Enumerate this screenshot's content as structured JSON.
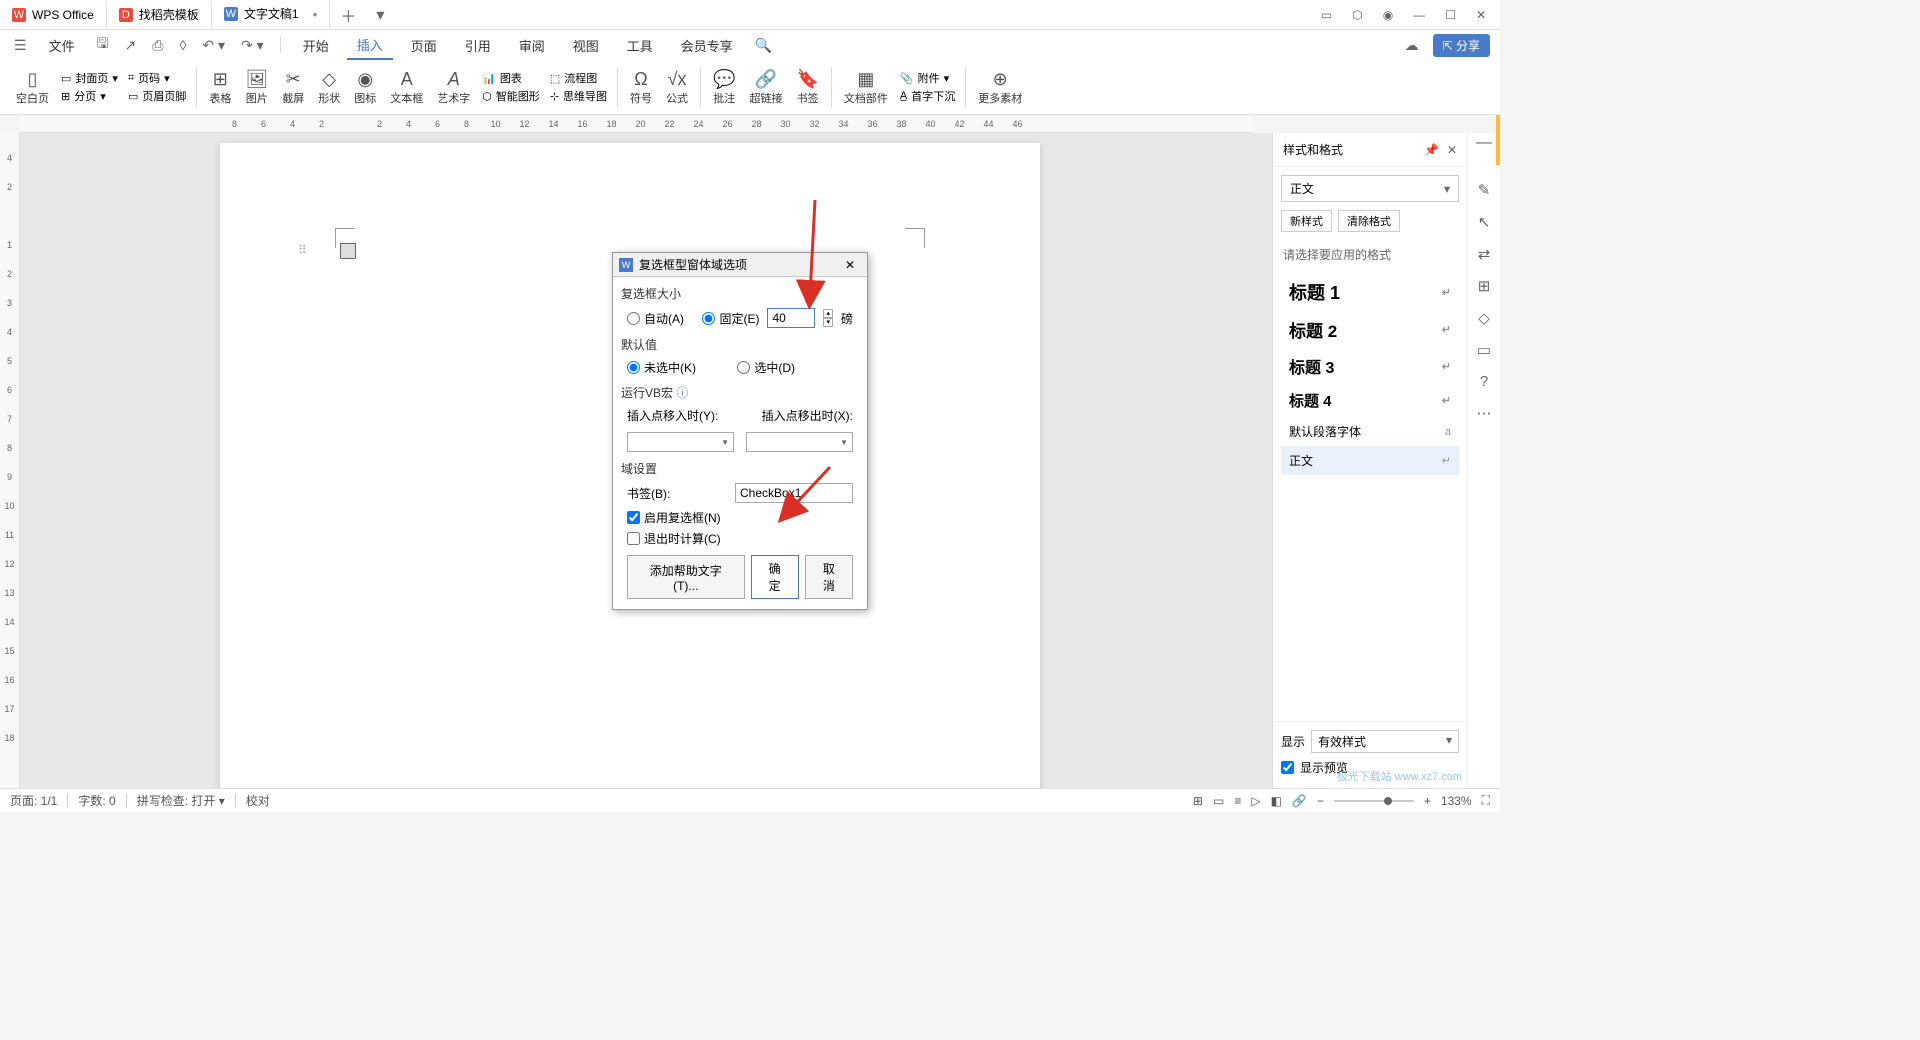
{
  "titlebar": {
    "app_name": "WPS Office",
    "tabs": [
      {
        "icon": "D",
        "label": "找稻壳模板"
      },
      {
        "icon": "W",
        "label": "文字文稿1"
      }
    ]
  },
  "menubar": {
    "file": "文件",
    "items": [
      "开始",
      "插入",
      "页面",
      "引用",
      "审阅",
      "视图",
      "工具",
      "会员专享"
    ],
    "active": "插入",
    "share": "分享"
  },
  "ribbon": {
    "blank_page": "空白页",
    "cover": "封面页",
    "page_num": "页码",
    "page_break": "分页",
    "header_footer": "页眉页脚",
    "table": "表格",
    "picture": "图片",
    "screenshot": "截屏",
    "shape": "形状",
    "icon": "图标",
    "textbox": "文本框",
    "wordart": "艺术字",
    "chart": "图表",
    "smartart": "智能图形",
    "flowchart": "流程图",
    "mindmap": "思维导图",
    "symbol": "符号",
    "formula": "公式",
    "comment": "批注",
    "hyperlink": "超链接",
    "bookmark": "书签",
    "docparts": "文档部件",
    "dropcap": "首字下沉",
    "attachment": "附件",
    "more": "更多素材"
  },
  "ruler_h": [
    "8",
    "6",
    "4",
    "2",
    "",
    "2",
    "4",
    "6",
    "8",
    "10",
    "12",
    "14",
    "16",
    "18",
    "20",
    "22",
    "24",
    "26",
    "28",
    "30",
    "32",
    "34",
    "36",
    "38",
    "40",
    "42",
    "44",
    "46"
  ],
  "ruler_v": [
    "4",
    "2",
    "",
    "1",
    "2",
    "3",
    "4",
    "5",
    "6",
    "7",
    "8",
    "9",
    "10",
    "11",
    "12",
    "13",
    "14",
    "15",
    "16",
    "17",
    "18"
  ],
  "dialog": {
    "title": "复选框型窗体域选项",
    "size_label": "复选框大小",
    "auto": "自动(A)",
    "fixed": "固定(E)",
    "fixed_value": "40",
    "unit": "磅",
    "default_label": "默认值",
    "unchecked": "未选中(K)",
    "checked": "选中(D)",
    "macro_label": "运行VB宏",
    "entry_label": "插入点移入时(Y):",
    "exit_label": "插入点移出时(X):",
    "field_label": "域设置",
    "bookmark_label": "书签(B):",
    "bookmark_value": "CheckBox1",
    "enable": "启用复选框(N)",
    "calc_exit": "退出时计算(C)",
    "help_text": "添加帮助文字(T)...",
    "ok": "确定",
    "cancel": "取消"
  },
  "styles_panel": {
    "title": "样式和格式",
    "current": "正文",
    "new_style": "新样式",
    "clear": "清除格式",
    "hint": "请选择要应用的格式",
    "items": [
      "标题 1",
      "标题 2",
      "标题 3",
      "标题 4",
      "默认段落字体",
      "正文"
    ],
    "show_label": "显示",
    "show_value": "有效样式",
    "preview": "显示预览"
  },
  "statusbar": {
    "page": "页面: 1/1",
    "words": "字数: 0",
    "spell": "拼写检查: 打开",
    "proof": "校对",
    "zoom": "133%"
  },
  "watermark": "极光下载站 www.xz7.com"
}
